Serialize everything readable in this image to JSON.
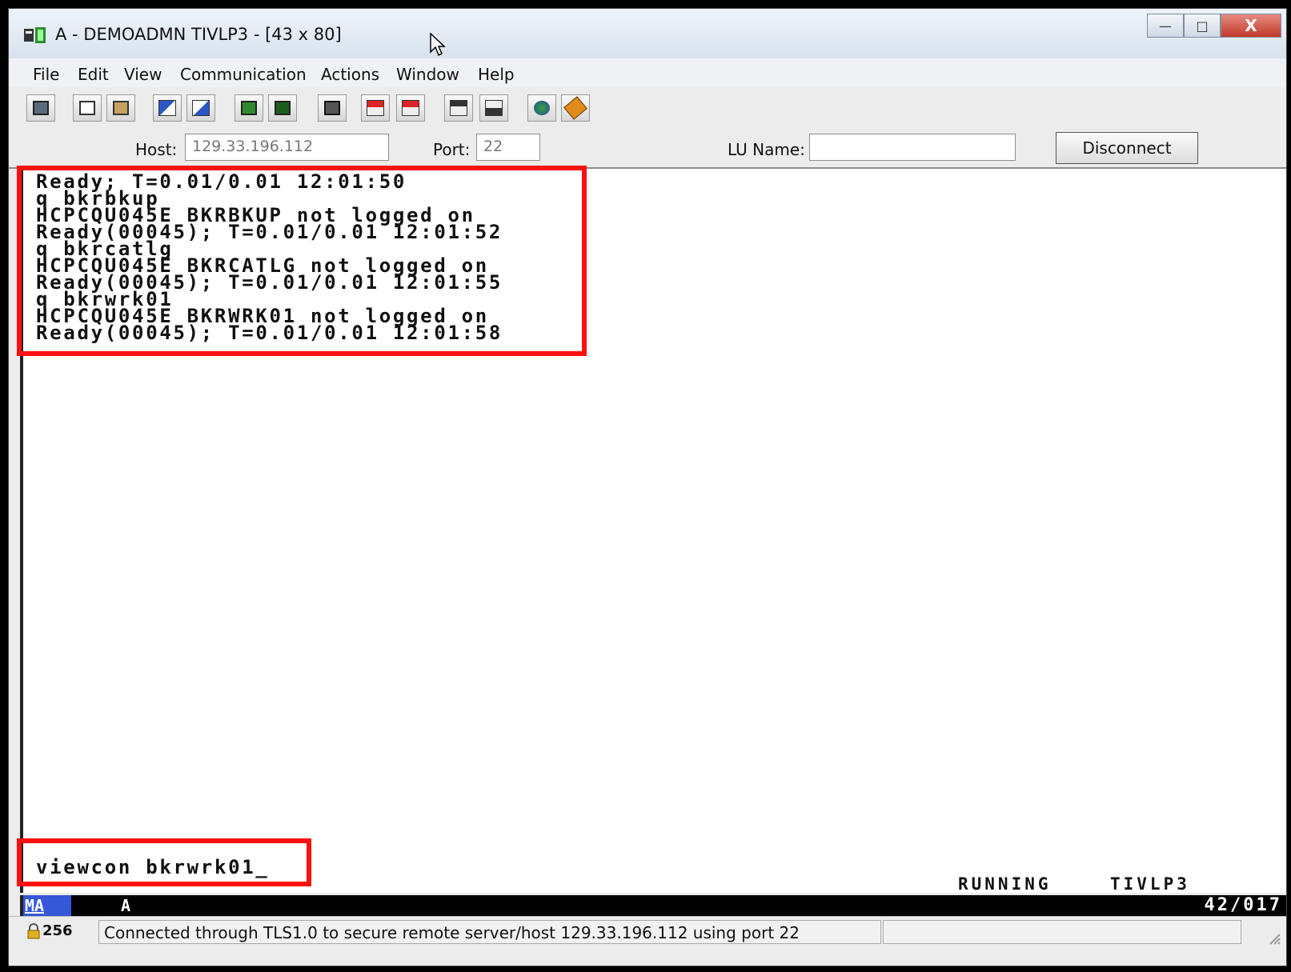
{
  "window": {
    "title": "A - DEMOADMN TIVLP3 - [43 x 80]",
    "controls": {
      "minimize": "—",
      "maximize": "□",
      "close": "X"
    }
  },
  "menu": [
    "File",
    "Edit",
    "View",
    "Communication",
    "Actions",
    "Window",
    "Help"
  ],
  "toolbar": {
    "icons": [
      "print-screen-icon",
      "copy-icon",
      "paste-icon",
      "send-file-icon",
      "receive-file-icon",
      "display-setup-icon",
      "keyboard-setup-icon",
      "macro-icon",
      "record-macro-icon",
      "play-macro-icon",
      "transfer-up-icon",
      "transfer-down-icon",
      "web-icon",
      "help-icon"
    ]
  },
  "connection": {
    "host_label": "Host:",
    "host_value": "129.33.196.112",
    "port_label": "Port:",
    "port_value": "22",
    "lu_label": "LU Name:",
    "lu_value": "",
    "disconnect_label": "Disconnect"
  },
  "terminal": {
    "lines": [
      "Ready; T=0.01/0.01 12:01:50",
      "q bkrbkup",
      "HCPCQU045E BKRBKUP not logged on",
      "Ready(00045); T=0.01/0.01 12:01:52",
      "q bkrcatlg",
      "HCPCQU045E BKRCATLG not logged on",
      "Ready(00045); T=0.01/0.01 12:01:55",
      "q bkrwrk01",
      "HCPCQU045E BKRWRK01 not logged on",
      "Ready(00045); T=0.01/0.01 12:01:58"
    ],
    "command_input": "viewcon bkrwrk01_",
    "status": "RUNNING",
    "system": "TIVLP3"
  },
  "oia": {
    "indicator": "MA",
    "session": "A",
    "cursor_position": "42/017"
  },
  "statusbar": {
    "lock_count": "256",
    "message": "Connected through TLS1.0 to secure remote server/host 129.33.196.112 using port 22"
  },
  "colors": {
    "highlight": "#ff1010",
    "oia_background": "#000000",
    "oia_ma": "#3557d8"
  }
}
